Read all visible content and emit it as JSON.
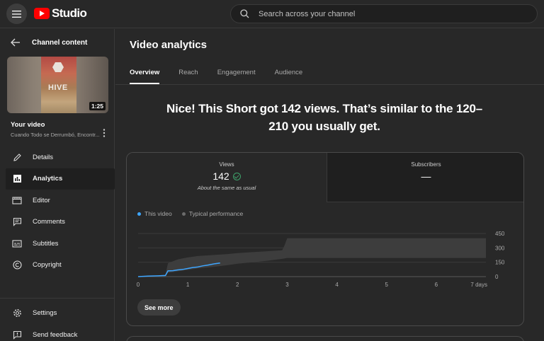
{
  "topbar": {
    "logo_text": "Studio",
    "search_placeholder": "Search across your channel"
  },
  "sidebar": {
    "back_label": "Channel content",
    "thumb_text": "HIVE",
    "duration": "1:25",
    "your_video": "Your video",
    "video_title": "Cuando Todo se Derrumbó, Encontr...",
    "items": [
      {
        "label": "Details",
        "icon": "pencil-icon"
      },
      {
        "label": "Analytics",
        "icon": "analytics-icon"
      },
      {
        "label": "Editor",
        "icon": "editor-icon"
      },
      {
        "label": "Comments",
        "icon": "comments-icon"
      },
      {
        "label": "Subtitles",
        "icon": "subtitles-icon"
      },
      {
        "label": "Copyright",
        "icon": "copyright-icon"
      }
    ],
    "bottom_items": [
      {
        "label": "Settings",
        "icon": "gear-icon"
      },
      {
        "label": "Send feedback",
        "icon": "feedback-icon"
      }
    ]
  },
  "main": {
    "title": "Video analytics",
    "tabs": [
      {
        "label": "Overview",
        "active": true
      },
      {
        "label": "Reach",
        "active": false
      },
      {
        "label": "Engagement",
        "active": false
      },
      {
        "label": "Audience",
        "active": false
      }
    ],
    "headline_line1": "Nice! This Short got 142 views. That’s similar to the 120–",
    "headline_line2": "210 you usually get."
  },
  "card": {
    "views_label": "Views",
    "views_value": "142",
    "views_sub": "About the same as usual",
    "subs_label": "Subscribers",
    "subs_value": "—",
    "legend_this": "This video",
    "legend_typical": "Typical performance",
    "see_more": "See more"
  },
  "colors": {
    "this_video": "#3ea6ff",
    "typical_band": "#3d3d3d",
    "check": "#3ea36b"
  },
  "chart_data": {
    "type": "line",
    "x_tick_labels": [
      "0",
      "1",
      "2",
      "3",
      "4",
      "5",
      "6",
      "7 days"
    ],
    "y_tick_labels": [
      "450",
      "300",
      "150",
      "0"
    ],
    "xlim": [
      0,
      7
    ],
    "ylim": [
      0,
      450
    ],
    "series": [
      {
        "name": "This video",
        "x": [
          0,
          0.2,
          0.4,
          0.55,
          0.6,
          0.7,
          0.8,
          0.9,
          1.0,
          1.1,
          1.2,
          1.3,
          1.4,
          1.5,
          1.55,
          1.6,
          1.65
        ],
        "y": [
          0,
          5,
          8,
          12,
          60,
          62,
          70,
          75,
          85,
          95,
          100,
          112,
          120,
          130,
          135,
          138,
          142
        ]
      }
    ],
    "typical_range": {
      "x": [
        0,
        0.3,
        0.5,
        0.55,
        0.6,
        0.8,
        1.0,
        1.2,
        1.5,
        1.8,
        2.0,
        2.3,
        2.6,
        2.9,
        2.95,
        3.0,
        3.5,
        4.0,
        5.0,
        6.0,
        7.0
      ],
      "lo": [
        0,
        0,
        2,
        5,
        40,
        55,
        70,
        85,
        100,
        120,
        135,
        150,
        165,
        185,
        190,
        195,
        195,
        195,
        195,
        195,
        195
      ],
      "hi": [
        0,
        2,
        10,
        20,
        140,
        180,
        200,
        215,
        225,
        235,
        245,
        255,
        265,
        275,
        330,
        400,
        400,
        400,
        400,
        400,
        400
      ]
    }
  }
}
